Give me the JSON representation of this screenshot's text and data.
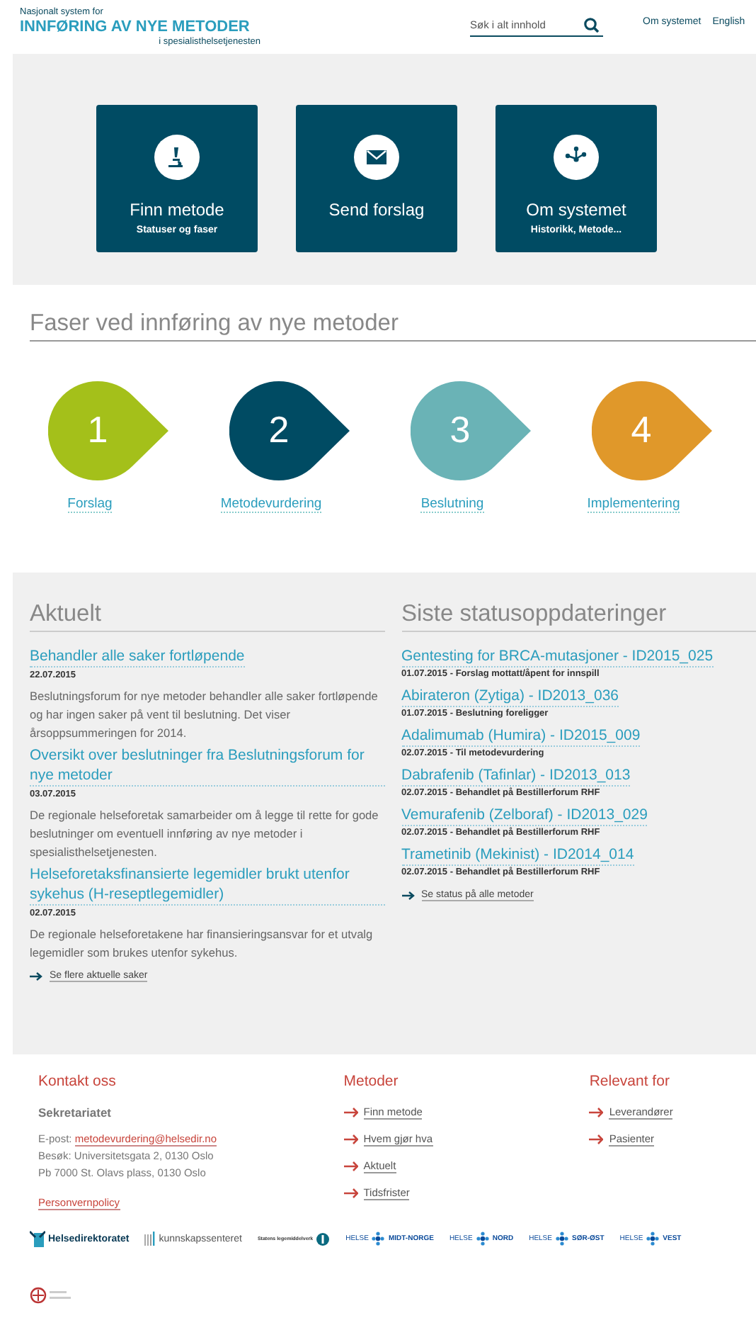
{
  "header": {
    "logo_top": "Nasjonalt system for",
    "logo_main": "INNFØRING AV NYE METODER",
    "logo_sub": "i spesialisthelsetjenesten",
    "search": {
      "placeholder": "Søk i alt innhold"
    },
    "nav": [
      "Om systemet",
      "English"
    ]
  },
  "tiles": [
    {
      "kind": "microscope",
      "title": "Finn metode",
      "subtitle": "Statuser og faser"
    },
    {
      "kind": "envelope",
      "title": "Send forslag"
    },
    {
      "kind": "network",
      "title": "Om systemet",
      "subtitle": "Historikk, Metode..."
    }
  ],
  "phases": {
    "title": "Faser ved innføring av nye metoder",
    "items": [
      {
        "number": "1",
        "label": "Forslag",
        "color": "#a4c01a"
      },
      {
        "number": "2",
        "label": "Metodevurdering",
        "color": "#004b63"
      },
      {
        "number": "3",
        "label": "Beslutning",
        "color": "#6ab3b6"
      },
      {
        "number": "4",
        "label": "Implementering",
        "color": "#e0982a"
      }
    ]
  },
  "news": {
    "title": "Aktuelt",
    "items": [
      {
        "title": "Behandler alle saker fortløpende",
        "date": "22.07.2015",
        "text": "Beslutningsforum for nye metoder behandler alle saker fortløpende og har ingen saker på vent til beslutning. Det viser årsoppsummeringen for 2014."
      },
      {
        "title": "Oversikt over beslutninger fra Beslutningsforum for nye metoder",
        "date": "03.07.2015",
        "text": "De regionale helseforetak samarbeider om å legge til rette for gode beslutninger om eventuell innføring av nye metoder i spesialisthelsetjenesten."
      },
      {
        "title": "Helseforetaksfinansierte legemidler brukt utenfor sykehus (H-reseptlegemidler)",
        "date": "02.07.2015",
        "text": "De regionale helseforetakene har finansieringsansvar for et utvalg legemidler som brukes utenfor sykehus."
      }
    ],
    "more": "Se flere aktuelle saker"
  },
  "status": {
    "title": "Siste statusoppdateringer",
    "items": [
      {
        "title": "Gentesting for BRCA-mutasjoner - ID2015_025",
        "date": "01.07.2015",
        "text": " - Forslag mottatt/åpent for innspill"
      },
      {
        "title": "Abirateron (Zytiga) - ID2013_036",
        "date": "01.07.2015",
        "text": " - Beslutning foreligger"
      },
      {
        "title": "Adalimumab (Humira) - ID2015_009",
        "date": "02.07.2015",
        "text": " - Til metodevurdering"
      },
      {
        "title": "Dabrafenib (Tafinlar) - ID2013_013",
        "date": "02.07.2015",
        "text": " - Behandlet på Bestillerforum RHF"
      },
      {
        "title": "Vemurafenib (Zelboraf) - ID2013_029",
        "date": "02.07.2015",
        "text": " - Behandlet på Bestillerforum RHF"
      },
      {
        "title": "Trametinib (Mekinist) - ID2014_014",
        "date": "02.07.2015",
        "text": " - Behandlet på Bestillerforum RHF"
      }
    ],
    "more": "Se status på alle metoder"
  },
  "footer": {
    "contact": {
      "title": "Kontakt oss",
      "name": "Sekretariatet",
      "email_label": "E-post: ",
      "email": "metodevurdering@helsedir.no",
      "lines": [
        "Besøk: Universitetsgata 2, 0130 Oslo",
        "Pb 7000 St. Olavs plass, 0130 Oslo"
      ],
      "privacy": "Personvernpolicy"
    },
    "columns": [
      {
        "title": "Metoder",
        "links": [
          "Finn metode",
          "Hvem gjør hva",
          "Aktuelt",
          "Tidsfrister"
        ]
      },
      {
        "title": "Relevant for",
        "links": [
          "Leverandører",
          "Pasienter"
        ]
      }
    ],
    "logos": [
      {
        "kind": "helsedir",
        "text": "Helsedirektoratet"
      },
      {
        "kind": "kunnskap",
        "text": "kunnskapssenteret"
      },
      {
        "kind": "slv",
        "text": "Statens legemiddelverk"
      },
      {
        "kind": "helse",
        "left": "HELSE",
        "right": "MIDT-NORGE"
      },
      {
        "kind": "helse",
        "left": "HELSE",
        "right": "NORD"
      },
      {
        "kind": "helse",
        "left": "HELSE",
        "right": "SØR-ØST"
      },
      {
        "kind": "helse",
        "left": "HELSE",
        "right": "VEST"
      },
      {
        "kind": "seal"
      }
    ]
  }
}
